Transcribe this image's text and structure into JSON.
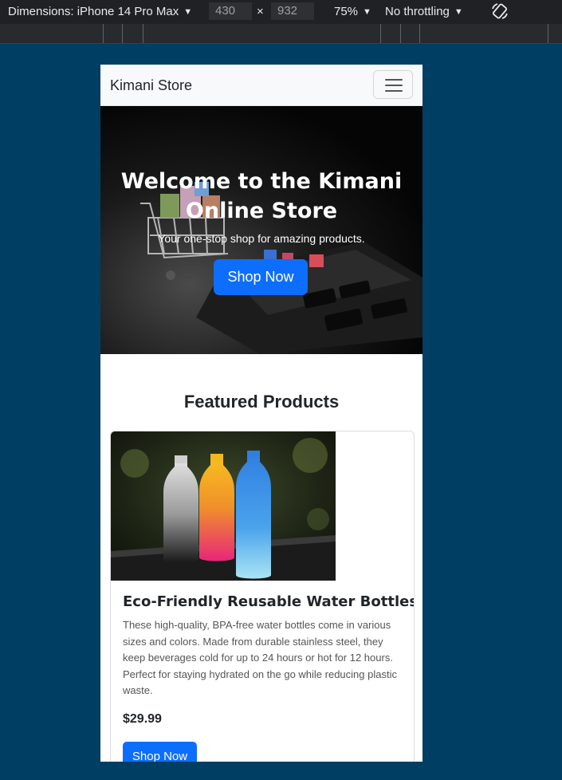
{
  "devtools": {
    "device_label": "Dimensions: iPhone 14 Pro Max",
    "width": "430",
    "times": "×",
    "height": "932",
    "zoom": "75%",
    "throttling": "No throttling"
  },
  "navbar": {
    "brand": "Kimani Store"
  },
  "hero": {
    "title": "Welcome to the Kimani Online Store",
    "subtitle": "Your one-stop shop for amazing products.",
    "button": "Shop Now"
  },
  "featured": {
    "heading": "Featured Products",
    "products": [
      {
        "title": "Eco-Friendly Reusable Water Bottles",
        "description": "These high-quality, BPA-free water bottles come in various sizes and colors. Made from durable stainless steel, they keep beverages cold for up to 24 hours or hot for 12 hours. Perfect for staying hydrated on the go while reducing plastic waste.",
        "price": "$29.99",
        "button": "Shop Now"
      }
    ]
  },
  "colors": {
    "primary": "#0d6efd",
    "page_background": "#003f63",
    "navbar_background": "#f8f9fa"
  }
}
